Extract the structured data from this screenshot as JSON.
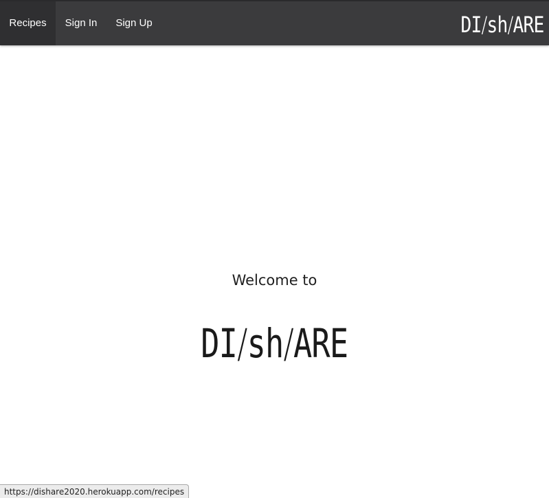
{
  "nav": {
    "items": [
      {
        "label": "Recipes",
        "active": true
      },
      {
        "label": "Sign In",
        "active": false
      },
      {
        "label": "Sign Up",
        "active": false
      }
    ],
    "logo": {
      "part1": "DI",
      "slash1": "/",
      "part2": "sh",
      "slash2": "/",
      "part3": "ARE"
    }
  },
  "main": {
    "welcome_text": "Welcome to",
    "logo": {
      "part1": "DI",
      "slash1": "/",
      "part2": "sh",
      "slash2": "/",
      "part3": "ARE"
    }
  },
  "status_bar": {
    "url": "https://dishare2020.herokuapp.com/recipes"
  },
  "colors": {
    "navbar_bg": "#3b3b3d",
    "active_item_bg": "#2f2f31",
    "text_light": "#ffffff",
    "text_dark": "#1f1f1f"
  }
}
